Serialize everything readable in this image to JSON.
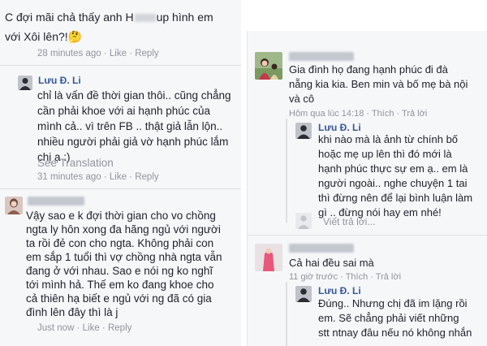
{
  "left": {
    "c1": {
      "lines": [
        "C đợi mãi chả thấy anh H",
        "up hình em",
        "với Xôi lên?!🤔"
      ],
      "time": "28 minutes ago",
      "like": "Like",
      "reply": "Reply"
    },
    "c2": {
      "name": "Lưu Đ. Li",
      "lines": [
        "chỉ là vấn đề thời gian thôi.. cũng chẳng",
        "cần phải khoe với ai hạnh phúc của",
        "mình cả.. vì trên FB .. thật giả lẫn lộn..",
        "nhiều người phải giả vờ hạnh phúc lắm",
        "chị ạ :)"
      ],
      "see_translation": "See Translation",
      "time": "31 minutes ago",
      "like": "Like",
      "reply": "Reply"
    },
    "c3": {
      "lines": [
        "Vậy sao e k đợi thời gian cho vo chồng",
        "ngta ly hôn xong đa hãng ngủ với người",
        "ta rồi đẻ con cho ngta. Không phải con",
        "em sắp 1 tuổi thì vợ chồng nhà ngta vẫn",
        "đang ở với nhau. Sao e nói ng ko nghĩ",
        "tới mình hả. Thế em ko đang khoe cho",
        "cả thiên hạ biết e ngủ với ng đã có gia",
        "đình lên đây thì là j"
      ],
      "time": "Just now",
      "like": "Like",
      "reply": "Reply"
    }
  },
  "right": {
    "c1": {
      "lines": [
        "Gia đình họ đang hạnh phúc đi đà",
        "nẵng kia kia. Ben min và bố mẹ bà nội",
        "và cô"
      ],
      "time": "Hôm qua lúc 14:18",
      "like": "Thích",
      "reply": "Trả lời"
    },
    "c2": {
      "name": "Lưu Đ. Li",
      "lines": [
        "khi nào mà là ảnh từ chính bố",
        "hoặc mẹ up lên thì đó mới là",
        "hạnh phúc thực sự em ạ.. em là",
        "người ngoài.. nghe chuyện 1 tai",
        "thì đừng nên để lại bình luận làm",
        "gì .. đừng nói hay em nhé!"
      ],
      "reply_placeholder": "Viết trả lời..."
    },
    "c3": {
      "lines": [
        "Cả hai đều sai mà"
      ],
      "time": "11 giờ trước",
      "like": "Thích",
      "reply": "Trả lời"
    },
    "c4": {
      "name": "Lưu Đ. Li",
      "lines": [
        "Đúng.. Nhưng chị đã im lặng rồi",
        "em. Sẽ chẳng phải viết những",
        "stt ntnay đâu nếu nó không nhắn"
      ]
    }
  }
}
